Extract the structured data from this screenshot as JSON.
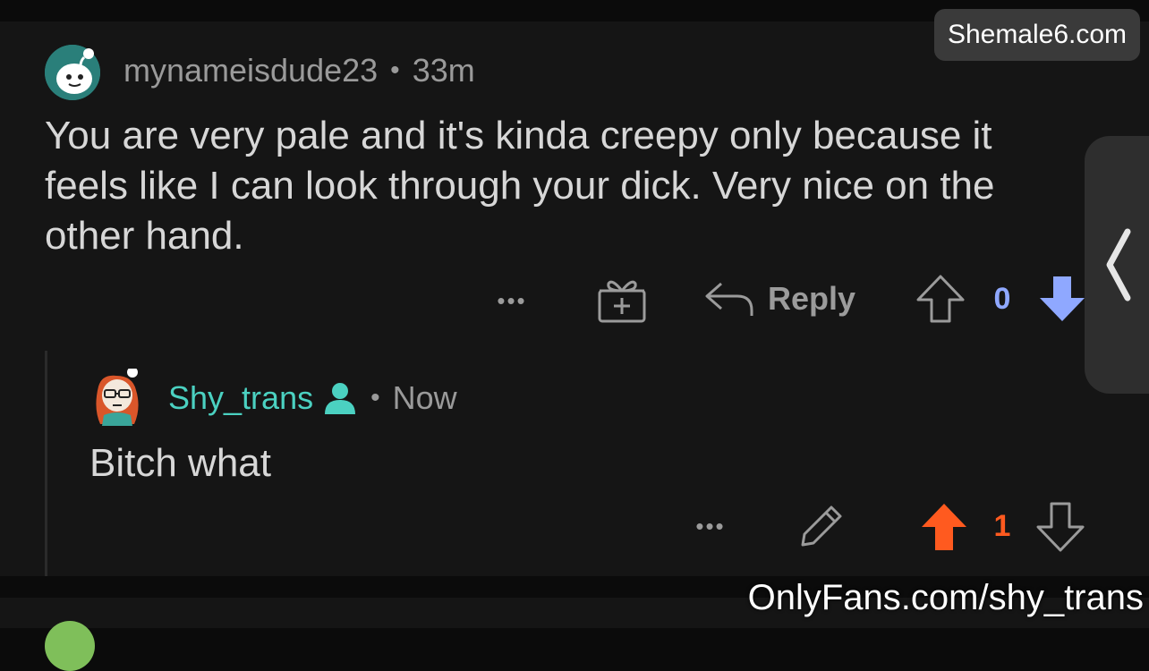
{
  "watermark_top": "Shemale6.com",
  "watermark_bottom": "OnlyFans.com/shy_trans",
  "comment": {
    "username": "mynameisdude23",
    "separator": "•",
    "time": "33m",
    "body": "You are very pale and it's kinda creepy only because it feels like I can look through your dick. Very nice on the other hand.",
    "more_label": "•••",
    "reply_label": "Reply",
    "vote_count": "0",
    "vote_state": "downvoted"
  },
  "reply": {
    "username": "Shy_trans",
    "separator": "•",
    "time": "Now",
    "body": "Bitch what",
    "more_label": "•••",
    "vote_count": "1",
    "vote_state": "upvoted"
  },
  "colors": {
    "background": "#151515",
    "text": "#d7d7d7",
    "muted": "#9a9a9a",
    "op_name": "#4bd1c1",
    "upvote": "#ff5a1f",
    "downvote": "#8fa8ff"
  }
}
